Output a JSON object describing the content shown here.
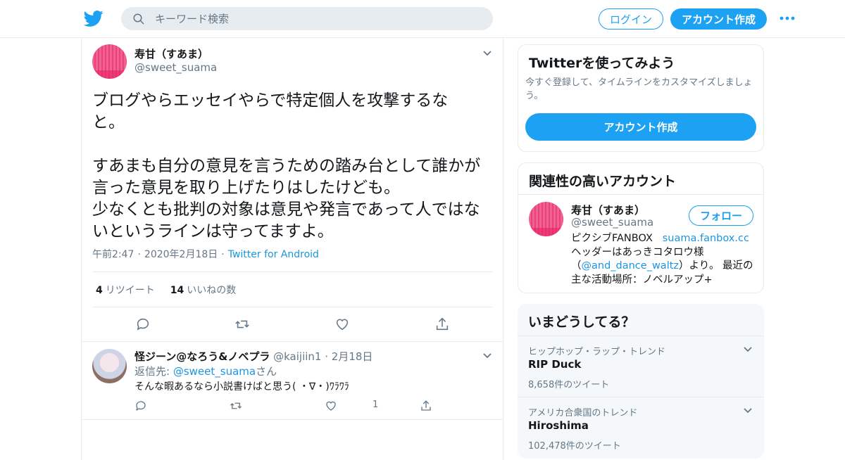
{
  "header": {
    "search_placeholder": "キーワード検索",
    "login_label": "ログイン",
    "signup_label": "アカウント作成"
  },
  "tweet": {
    "author_name": "寿甘（すあま）",
    "author_handle": "@sweet_suama",
    "text": "ブログやらエッセイやらで特定個人を攻撃するな\nと。\n\nすあまも自分の意見を言うための踏み台として誰かが\n言った意見を取り上げたりはしたけども。\n少なくとも批判の対象は意見や発言であって人ではな\nいというラインは守ってますよ。",
    "time": "午前2:47",
    "date": "2020年2月18日",
    "source": "Twitter for Android",
    "retweet_count": "4",
    "retweet_label": "リツイート",
    "like_count": "14",
    "like_label": "いいねの数"
  },
  "reply": {
    "author_name": "怪ジーン@なろう&ノベプラ",
    "author_handle": "@kaijiin1",
    "date": "2月18日",
    "reply_to_prefix": "返信先:",
    "reply_to_handle": "@sweet_suama",
    "reply_to_suffix": "さん",
    "text": "そんな暇あるなら小説書けばと思う( ・∇・)ﾜﾗﾜﾗ",
    "like_count": "1"
  },
  "sidebar": {
    "signup": {
      "title": "Twitterを使ってみよう",
      "description": "今すぐ登録して、タイムラインをカスタマイズしましょう。",
      "button_label": "アカウント作成"
    },
    "related": {
      "title": "関連性の高いアカウント",
      "name": "寿甘（すあま）",
      "handle": "@sweet_suama",
      "follow_label": "フォロー",
      "bio_prefix": "ピクシブFANBOX",
      "bio_link": "suama.fanbox.cc",
      "bio_line2": "ヘッダーはあっきコタロウ様",
      "bio_paren_open": "（",
      "bio_mention": "@and_dance_waltz",
      "bio_rest": "）より。 最近の主な活動場所：ノベルアップ+"
    },
    "trends": {
      "title": "いまどうしてる？",
      "items": [
        {
          "context": "ヒップホップ・ラップ・トレンド",
          "name": "RIP Duck",
          "count": "8,658件のツイート"
        },
        {
          "context": "アメリカ合衆国のトレンド",
          "name": "Hiroshima",
          "count": "102,478件のツイート"
        }
      ]
    }
  },
  "colors": {
    "brand": "#1da1f2",
    "link": "#1b95e0",
    "text": "#14171a",
    "secondary": "#657786",
    "border": "#e6ecf0"
  }
}
